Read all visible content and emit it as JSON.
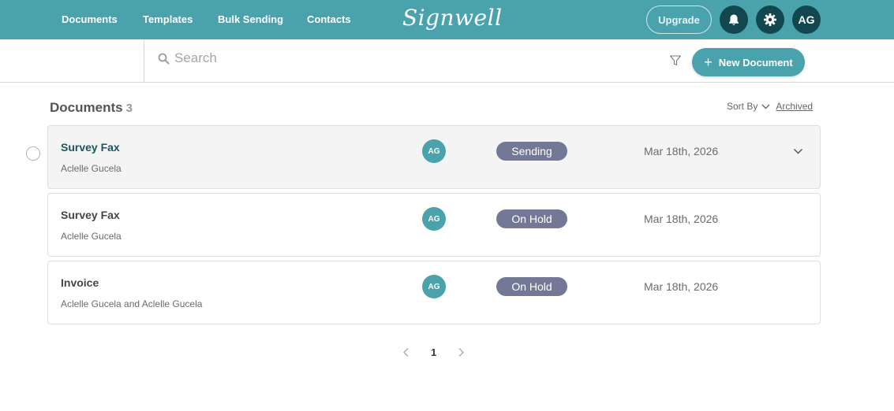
{
  "nav": {
    "links": [
      "Documents",
      "Templates",
      "Bulk Sending",
      "Contacts"
    ],
    "logo": "Signwell",
    "upgrade_label": "Upgrade",
    "avatar_initials": "AG",
    "icons": [
      "bell-icon",
      "gear-icon"
    ],
    "bar_color": "#4aa2ad"
  },
  "search": {
    "placeholder": "Search",
    "value": ""
  },
  "new_document_label": "New Document",
  "section": {
    "title": "Documents",
    "count": "3",
    "sort_label": "Sort By",
    "archived_label": "Archived"
  },
  "documents": [
    {
      "name": "Survey Fax",
      "recipients": "Aclelle Gucela",
      "avatar": "AG",
      "status": "Sending",
      "date": "Mar 18th, 2026"
    },
    {
      "name": "Survey Fax",
      "recipients": "Aclelle Gucela",
      "avatar": "AG",
      "status": "On Hold",
      "date": "Mar 18th, 2026"
    },
    {
      "name": "Invoice",
      "recipients": "Aclelle Gucela and Aclelle Gucela",
      "avatar": "AG",
      "status": "On Hold",
      "date": "Mar 18th, 2026"
    }
  ],
  "pagination": {
    "current_page": "1"
  },
  "colors": {
    "accent": "#4aa2ad",
    "dark_button": "#12474f",
    "status_badge": "#737896"
  }
}
